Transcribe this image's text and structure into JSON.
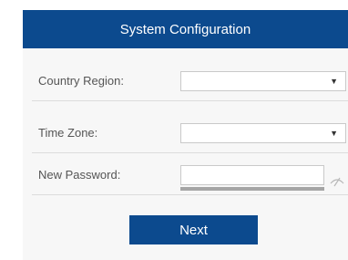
{
  "header": {
    "title": "System Configuration"
  },
  "form": {
    "country_region": {
      "label": "Country Region:",
      "value": "",
      "arrow": "▼"
    },
    "time_zone": {
      "label": "Time Zone:",
      "value": "",
      "arrow": "▼"
    },
    "new_password": {
      "label": "New Password:",
      "value": "",
      "toggle_icon": "eye-slash-icon"
    }
  },
  "actions": {
    "next_label": "Next"
  },
  "colors": {
    "accent": "#0c4a8e",
    "body_bg": "#f7f7f7",
    "divider": "#dcdcdc",
    "strength_bar": "#a5a5a5"
  }
}
